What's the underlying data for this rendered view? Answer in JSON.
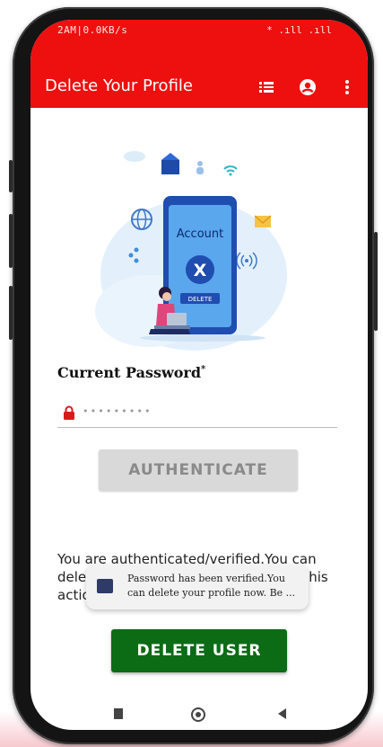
{
  "status_bar": {
    "left": "2AM|0.0KB/s",
    "right": "* .ıll .ıll"
  },
  "app_bar": {
    "title": "Delete Your Profile",
    "icons": [
      "list-icon",
      "account-circle-icon",
      "more-vert-icon"
    ],
    "color": "#ee0f0f"
  },
  "illustration": {
    "account_label": "Account",
    "x_label": "X",
    "delete_label": "DELETE"
  },
  "form": {
    "label": "Current Password",
    "required_mark": "*",
    "password_value": "•••••••••"
  },
  "buttons": {
    "authenticate": "AUTHENTICATE",
    "delete_user": "DELETE USER",
    "delete_color": "#0c6b15"
  },
  "message": "You are authenticated/verified.You can delete your profile now. Be cautious this action can't be undone",
  "toast": {
    "text": "Password has been verified.You can delete your profile now. Be ..."
  }
}
